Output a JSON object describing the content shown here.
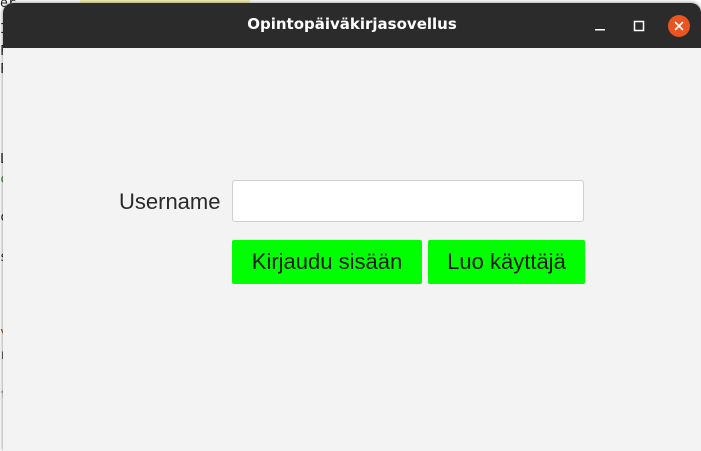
{
  "window": {
    "title": "Opintopäiväkirjasovellus",
    "controls": {
      "minimize_icon": "minimize-icon",
      "maximize_icon": "maximize-icon",
      "close_icon": "close-icon",
      "close_color": "#e95420"
    }
  },
  "login": {
    "username_label": "Username",
    "username_value": "",
    "login_button": "Kirjaudu sisään",
    "create_user_button": "Luo käyttäjä",
    "button_color": "#00ff00"
  },
  "background": {
    "colors": {
      "titlebar": "#2b2b2b",
      "content": "#f3f3f3"
    }
  }
}
